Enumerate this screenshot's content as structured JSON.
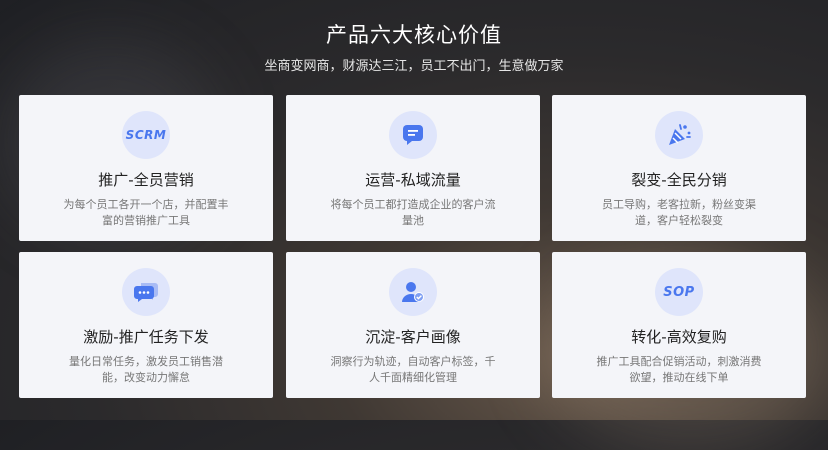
{
  "header": {
    "title": "产品六大核心价值",
    "subtitle": "坐商变网商，财源达三江，员工不出门，生意做万家"
  },
  "cards": [
    {
      "icon": "SCRM",
      "icon_name": "scrm-badge-icon",
      "title": "推广-全员营销",
      "desc": "为每个员工各开一个店，并配置丰富的营销推广工具"
    },
    {
      "icon": "",
      "icon_name": "chat-bubble-icon",
      "title": "运营-私域流量",
      "desc": "将每个员工都打造成企业的客户流量池"
    },
    {
      "icon": "",
      "icon_name": "party-popper-icon",
      "title": "裂变-全民分销",
      "desc": "员工导购，老客拉新，粉丝变渠道，客户轻松裂变"
    },
    {
      "icon": "",
      "icon_name": "message-dots-icon",
      "title": "激励-推广任务下发",
      "desc": "量化日常任务，激发员工销售潜能，改变动力懈怠"
    },
    {
      "icon": "",
      "icon_name": "user-check-icon",
      "title": "沉淀-客户画像",
      "desc": "洞察行为轨迹，自动客户标签，千人千面精细化管理"
    },
    {
      "icon": "SOP",
      "icon_name": "sop-badge-icon",
      "title": "转化-高效复购",
      "desc": "推广工具配合促销活动，刺激消费欲望，推动在线下单"
    }
  ],
  "colors": {
    "accent": "#4a77ee",
    "icon_bg": "#dfe5fb",
    "card_bg": "#f4f5f9"
  }
}
